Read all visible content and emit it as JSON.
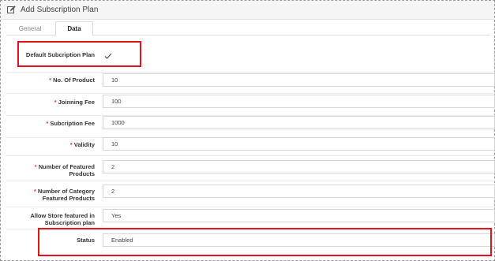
{
  "panel": {
    "title": "Add Subscription Plan",
    "title_icon": "pencil-square-icon"
  },
  "tabs": [
    {
      "label": "General",
      "active": false
    },
    {
      "label": "Data",
      "active": true
    }
  ],
  "form": {
    "default_plan": {
      "label": "Default Subcription Plan",
      "checked": true
    },
    "no_of_product": {
      "label": "No. Of Product",
      "required": true,
      "value": "10"
    },
    "joining_fee": {
      "label": "Joinning Fee",
      "required": true,
      "value": "100"
    },
    "subscription_fee": {
      "label": "Subcription Fee",
      "required": true,
      "value": "1000"
    },
    "validity": {
      "label": "Validity",
      "required": true,
      "value": "10"
    },
    "featured_products": {
      "label": "Number of Featured Products",
      "required": true,
      "value": "2"
    },
    "category_featured_products": {
      "label": "Number of Category Featured Products",
      "required": true,
      "value": "2"
    },
    "allow_store_featured": {
      "label": "Allow Store featured in Subscription plan",
      "value": "Yes"
    },
    "status": {
      "label": "Status",
      "value": "Enabled"
    }
  },
  "colors": {
    "highlight": "#e3131b",
    "required": "#e23b3b"
  }
}
